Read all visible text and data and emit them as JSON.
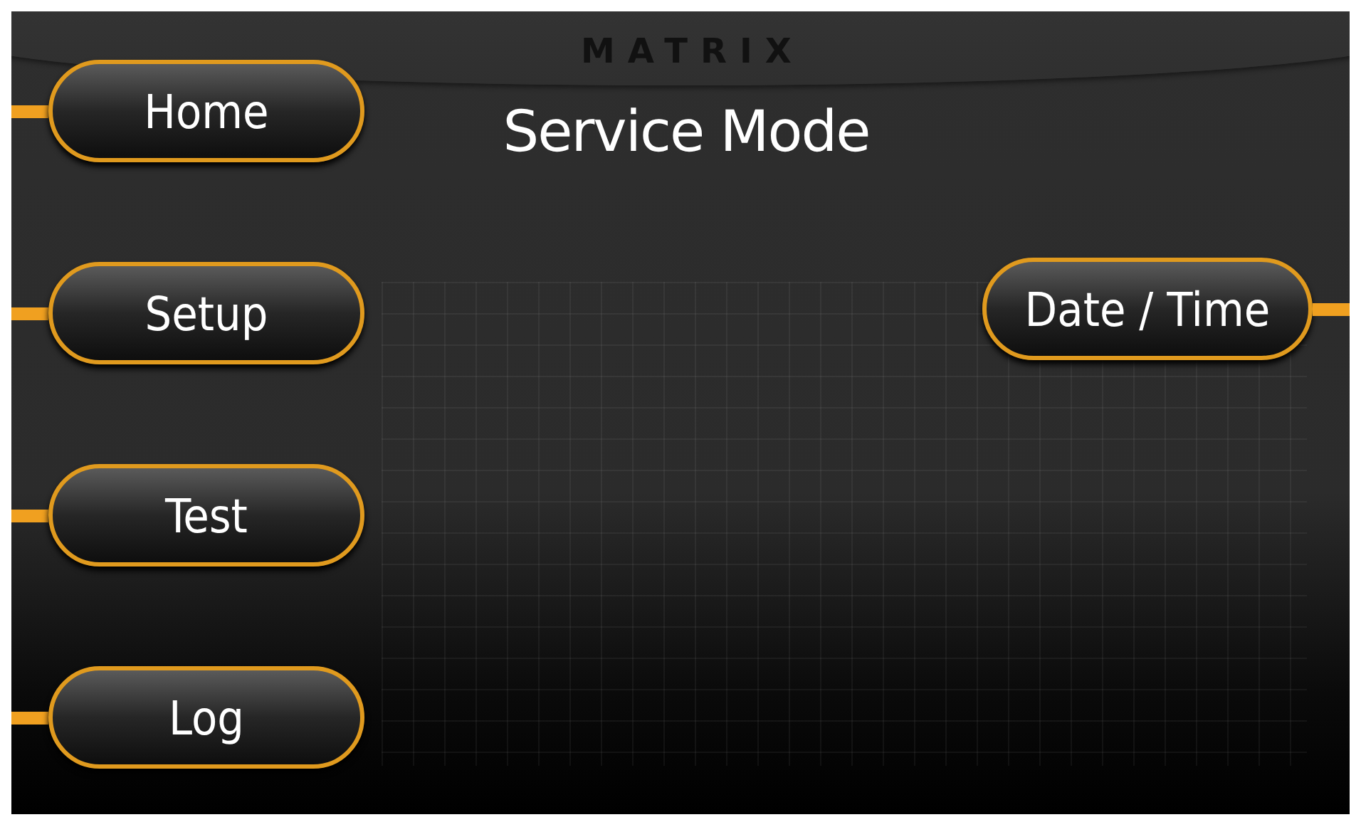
{
  "header": {
    "logo": "MATRIX"
  },
  "title": "Service Mode",
  "left_buttons": [
    {
      "label": "Home"
    },
    {
      "label": "Setup"
    },
    {
      "label": "Test"
    },
    {
      "label": "Log"
    }
  ],
  "right_buttons": [
    {
      "label": "Date / Time"
    }
  ]
}
